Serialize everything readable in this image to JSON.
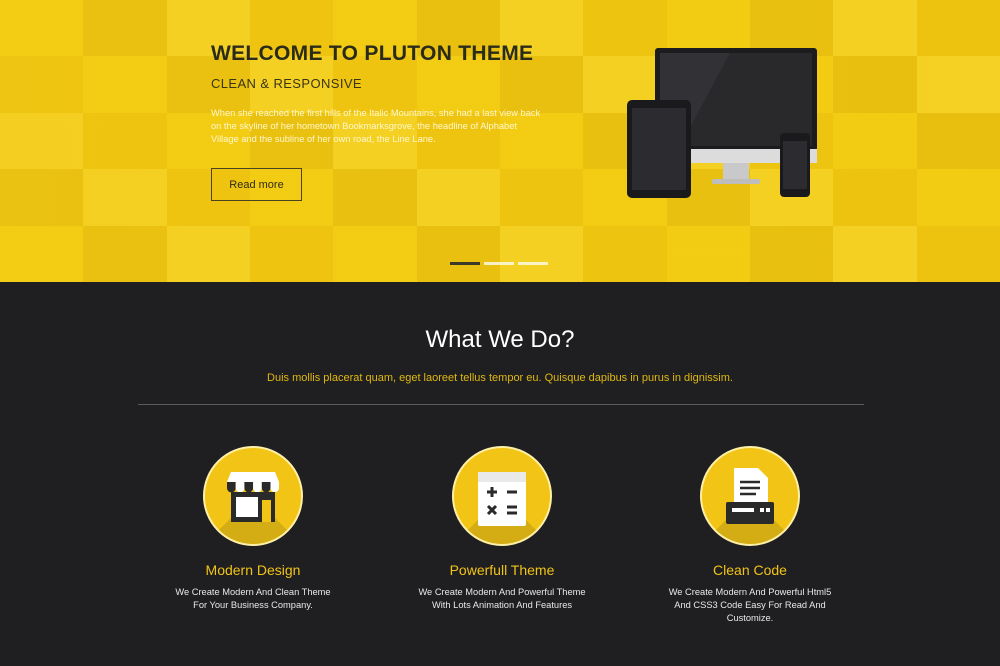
{
  "hero": {
    "title": "WELCOME TO PLUTON THEME",
    "subtitle": "CLEAN & RESPONSIVE",
    "text": "When she reached the first hills of the Italic Mountains, she had a last view back on the skyline of her hometown Bookmarksgrove, the headline of Alphabet Village and the subline of her own road, the Line Lane.",
    "button_label": "Read more",
    "slides": [
      true,
      false,
      false
    ]
  },
  "services": {
    "title": "What We Do?",
    "subtitle": "Duis mollis placerat quam, eget laoreet tellus tempor eu. Quisque dapibus in purus in dignissim.",
    "features": [
      {
        "icon": "storefront-icon",
        "title": "Modern Design",
        "text": "We Create Modern And Clean Theme For Your Business Company."
      },
      {
        "icon": "calculator-icon",
        "title": "Powerfull Theme",
        "text": "We Create Modern And Powerful Theme With Lots Animation And Features"
      },
      {
        "icon": "printer-icon",
        "title": "Clean Code",
        "text": "We Create Modern And Powerful Html5 And CSS3 Code Easy For Read And Customize."
      }
    ]
  },
  "colors": {
    "accent": "#f2c416",
    "dark_background": "#1f1f22",
    "hero_background": "#f2cc12"
  }
}
